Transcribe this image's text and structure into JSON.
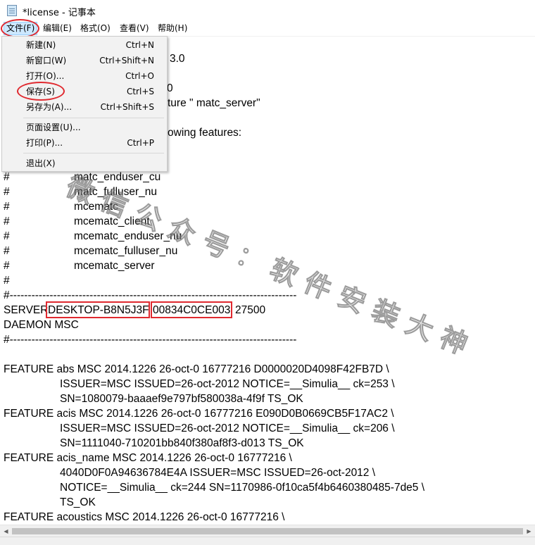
{
  "window": {
    "title": "*license - 记事本",
    "icon": "notepad-icon"
  },
  "menubar": {
    "items": [
      {
        "label": "文件(F)"
      },
      {
        "label": "编辑(E)"
      },
      {
        "label": "格式(O)"
      },
      {
        "label": "查看(V)"
      },
      {
        "label": "帮助(H)"
      }
    ]
  },
  "file_menu": {
    "items": [
      {
        "label": "新建(N)",
        "shortcut": "Ctrl+N"
      },
      {
        "label": "新窗口(W)",
        "shortcut": "Ctrl+Shift+N"
      },
      {
        "label": "打开(O)...",
        "shortcut": "Ctrl+O"
      },
      {
        "label": "保存(S)",
        "shortcut": "Ctrl+S"
      },
      {
        "label": "另存为(A)...",
        "shortcut": "Ctrl+Shift+S"
      },
      {
        "label": "页面设置(U)...",
        "shortcut": ""
      },
      {
        "label": "打印(P)...",
        "shortcut": "Ctrl+P"
      },
      {
        "label": "退出(X)",
        "shortcut": ""
      }
    ]
  },
  "editor": {
    "partial_lines": [
      "3.0",
      "0",
      "ture \" matc_server\"",
      "owing features:"
    ],
    "feature_lines": [
      {
        "hash": "#",
        "text": "matc_enduser_cu"
      },
      {
        "hash": "#",
        "text": "matc_fulluser_nu"
      },
      {
        "hash": "#",
        "text": "mcematc"
      },
      {
        "hash": "#",
        "text": "mcematc_client"
      },
      {
        "hash": "#",
        "text": "mcematc_enduser_nu"
      },
      {
        "hash": "#",
        "text": "mcematc_fulluser_nu"
      },
      {
        "hash": "#",
        "text": "mcematc_server"
      },
      {
        "hash": "#",
        "text": ""
      }
    ],
    "separator_top": "#-------------------------------------------------------------------------------",
    "server_line": {
      "keyword": "SERVER",
      "hostname": "DESKTOP-B8N5J3F",
      "hostid": "00834C0CE003",
      "port": "27500"
    },
    "daemon_line": "DAEMON MSC",
    "separator_bottom": "#-------------------------------------------------------------------------------",
    "features": [
      {
        "first": "FEATURE abs MSC 2014.1226 26-oct-0 16777216 D0000020D4098F42FB7D \\",
        "rest": [
          "ISSUER=MSC ISSUED=26-oct-2012 NOTICE=__Simulia__ ck=253 \\",
          "SN=1080079-baaaef9e797bf580038a-4f9f TS_OK"
        ]
      },
      {
        "first": "FEATURE acis MSC 2014.1226 26-oct-0 16777216 E090D0B0669CB5F17AC2 \\",
        "rest": [
          "ISSUER=MSC ISSUED=26-oct-2012 NOTICE=__Simulia__ ck=206 \\",
          "SN=1111040-710201bb840f380af8f3-d013 TS_OK"
        ]
      },
      {
        "first": "FEATURE acis_name MSC 2014.1226 26-oct-0 16777216 \\",
        "rest": [
          "4040D0F0A94636784E4A ISSUER=MSC ISSUED=26-oct-2012 \\",
          "NOTICE=__Simulia__ ck=244 SN=1170986-0f10ca5f4b6460380485-7de5 \\",
          "TS_OK"
        ]
      }
    ],
    "cut_line": "FEATURE acoustics MSC 2014.1226 26-oct-0 16777216 \\"
  },
  "watermark": "微信公众号：软件安装大神",
  "colors": {
    "highlight": "#e0292f",
    "menu_active": "#cce8ff"
  }
}
